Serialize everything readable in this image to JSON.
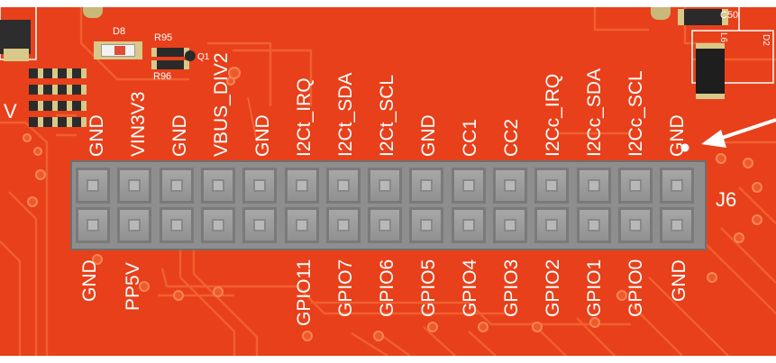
{
  "board": {
    "connector_label": "J6",
    "components": {
      "d8": "D8",
      "r95": "R95",
      "r96": "R96",
      "q1": "Q1",
      "c50": "C50",
      "l6": "L6",
      "d2": "D2",
      "edge_v": "V"
    },
    "top_pins": [
      "GND",
      "VIN3V3",
      "GND",
      "VBUS_DIV2",
      "GND",
      "I2Ct_IRQ",
      "I2Ct_SDA",
      "I2Ct_SCL",
      "GND",
      "CC1",
      "CC2",
      "I2Cc_IRQ",
      "I2Cc_SDA",
      "I2Cc_SCL",
      "GND"
    ],
    "bottom_pins": [
      "GND",
      "PP5V",
      "",
      "",
      "",
      "GPIO11",
      "GPIO7",
      "GPIO6",
      "GPIO5",
      "GPIO4",
      "GPIO3",
      "GPIO2",
      "GPIO1",
      "GPIO0",
      "GND"
    ],
    "colors": {
      "pcb": "#e8401a",
      "trace": "#f0602f",
      "header": "#8e8e8e",
      "silkscreen": "#ffffff"
    }
  }
}
